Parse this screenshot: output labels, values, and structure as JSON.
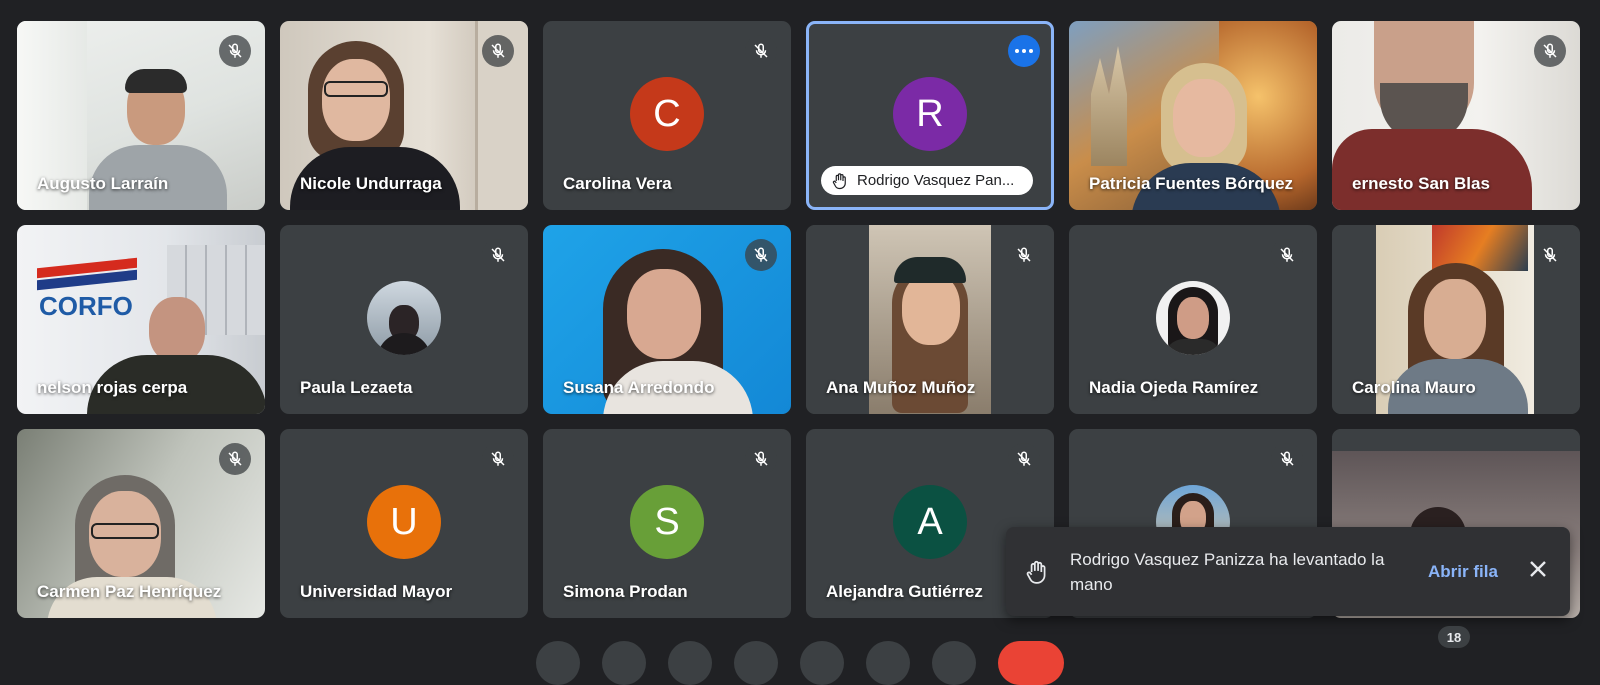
{
  "participants": [
    {
      "name": "Augusto Larraín",
      "type": "video"
    },
    {
      "name": "Nicole Undurraga",
      "type": "video"
    },
    {
      "name": "Carolina Vera",
      "type": "initial",
      "initial": "C",
      "color": "#c5391a"
    },
    {
      "name": "Rodrigo Vasquez Pan...",
      "type": "initial",
      "initial": "R",
      "color": "#7b2aa6",
      "hand_raised": true
    },
    {
      "name": "Patricia Fuentes Bórquez",
      "type": "video"
    },
    {
      "name": "ernesto San Blas",
      "type": "video"
    },
    {
      "name": "nelson rojas cerpa",
      "type": "video"
    },
    {
      "name": "Paula Lezaeta",
      "type": "photo"
    },
    {
      "name": "Susana Arredondo",
      "type": "video"
    },
    {
      "name": "Ana Muñoz Muñoz",
      "type": "video"
    },
    {
      "name": "Nadia Ojeda Ramírez",
      "type": "photo"
    },
    {
      "name": "Carolina Mauro",
      "type": "video"
    },
    {
      "name": "Carmen Paz Henríquez",
      "type": "video"
    },
    {
      "name": "Universidad Mayor",
      "type": "initial",
      "initial": "U",
      "color": "#e8710a"
    },
    {
      "name": "Simona Prodan",
      "type": "initial",
      "initial": "S",
      "color": "#689f38"
    },
    {
      "name": "Alejandra Gutiérrez",
      "type": "initial",
      "initial": "A",
      "color": "#0b5142"
    },
    {
      "name": "",
      "type": "photo"
    },
    {
      "name": "",
      "type": "video"
    }
  ],
  "corfo_logo_text": "CORFO",
  "notification": {
    "message": "Rodrigo Vasquez Panizza ha levantado la mano",
    "action": "Abrir fila"
  },
  "participant_count": "18",
  "colors": {
    "background": "#202124",
    "tile": "#3c4043",
    "accent": "#8ab4f8",
    "end_call": "#ea4335"
  }
}
